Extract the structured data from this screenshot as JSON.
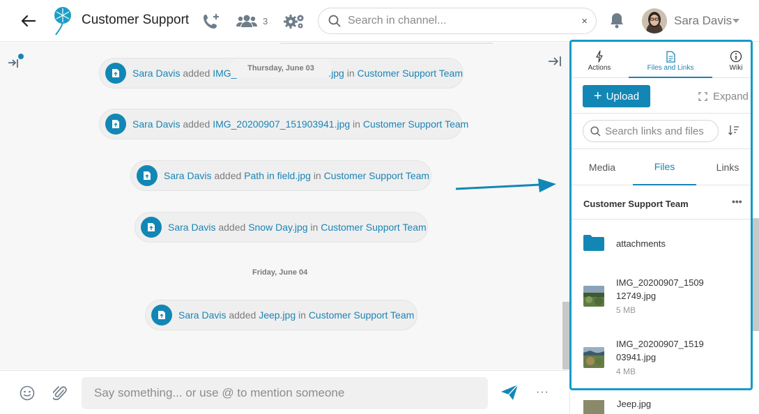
{
  "header": {
    "back_icon": "arrow-left-icon",
    "logo_icon": "dandelion-logo-icon",
    "channel_title": "Customer Support",
    "call_icon": "phone-add-icon",
    "members_icon": "users-icon",
    "member_count": "3",
    "settings_icon": "gears-icon",
    "search_placeholder": "Search in channel...",
    "search_clear": "×",
    "bell_icon": "bell-icon",
    "user_name": "Sara Davis"
  },
  "chat": {
    "floating_date": "Thursday, June 03",
    "messages": [
      {
        "user": "Sara Davis",
        "verb": "added",
        "file": "IMG_2",
        "file_tail": ".jpg",
        "prep": "in",
        "team": "Customer Support Team"
      },
      {
        "user": "Sara Davis",
        "verb": "added",
        "file": "IMG_20200907_151903941.jpg",
        "prep": "in",
        "team": "Customer Support Team"
      },
      {
        "user": "Sara Davis",
        "verb": "added",
        "file": "Path in field.jpg",
        "prep": "in",
        "team": "Customer Support Team"
      },
      {
        "user": "Sara Davis",
        "verb": "added",
        "file": "Snow Day.jpg",
        "prep": "in",
        "team": "Customer Support Team"
      },
      {
        "user": "Sara Davis",
        "verb": "added",
        "file": "Jeep.jpg",
        "prep": "in",
        "team": "Customer Support Team"
      }
    ],
    "date_separator": "Friday, June 04"
  },
  "composer": {
    "placeholder": "Say something... or use @ to mention someone",
    "more": "···"
  },
  "panel": {
    "top_tabs": [
      {
        "label": "Actions",
        "icon": "lightning-icon"
      },
      {
        "label": "Files and Links",
        "icon": "document-icon"
      },
      {
        "label": "Wiki",
        "icon": "info-icon"
      }
    ],
    "active_top_tab": "Files and Links",
    "upload_label": "Upload",
    "expand_label": "Expand",
    "search_placeholder": "Search links and files",
    "sub_tabs": [
      "Media",
      "Files",
      "Links"
    ],
    "active_sub_tab": "Files",
    "group_name": "Customer Support Team",
    "group_menu": "•••",
    "folder": {
      "name": "attachments",
      "icon": "folder-icon"
    },
    "files": [
      {
        "name": "IMG_20200907_1509 12749.jpg",
        "size": "5 MB"
      },
      {
        "name": "IMG_20200907_1519 03941.jpg",
        "size": "4 MB"
      }
    ],
    "peek_file": "Jeep.jpg"
  },
  "colors": {
    "accent": "#1287b5",
    "link": "#1a84b5",
    "panel_border": "#149bc6"
  }
}
